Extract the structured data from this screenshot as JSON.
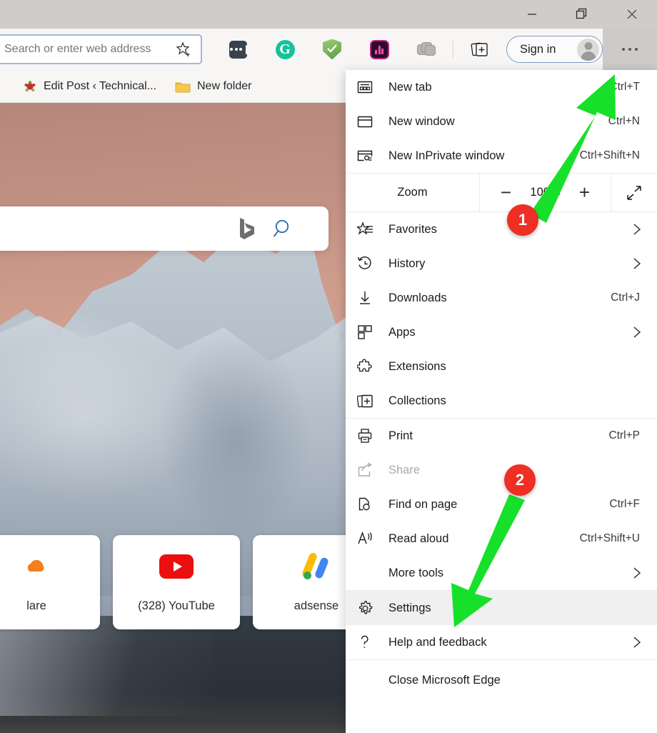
{
  "window": {
    "controls": [
      {
        "name": "minimize",
        "glyph": "minimize-icon"
      },
      {
        "name": "restore",
        "glyph": "restore-icon"
      },
      {
        "name": "close",
        "glyph": "close-icon"
      }
    ]
  },
  "toolbar": {
    "address_value": "",
    "address_placeholder": "Search or enter web address",
    "favorite_icon": "add-favorite-star-icon",
    "extensions": [
      {
        "name": "password-manager-extension",
        "icon": "password-dots-icon"
      },
      {
        "name": "grammarly-extension",
        "icon": "grammarly-g-icon",
        "letter": "G"
      },
      {
        "name": "adblock-shield-extension",
        "icon": "shield-check-icon"
      },
      {
        "name": "analytics-extension",
        "icon": "purple-bars-icon"
      },
      {
        "name": "screenshot-extension",
        "icon": "grey-stack-icon"
      }
    ],
    "collections_icon": "collections-icon",
    "signin_label": "Sign in",
    "avatar_icon": "default-avatar-icon",
    "settings_and_more_icon": "ellipsis-icon"
  },
  "bookmarks": [
    {
      "label": "Edit Post ‹ Technical...",
      "icon": "wordpress-favicon"
    },
    {
      "label": "New folder",
      "icon": "folder-icon"
    }
  ],
  "newtab": {
    "search_placeholder": "",
    "bing_icon": "bing-b-icon",
    "search_icon": "magnifier-icon",
    "tiles": [
      {
        "label": "lare",
        "icon": "cloudflare-icon",
        "partial": true
      },
      {
        "label": "(328) YouTube",
        "icon": "youtube-icon"
      },
      {
        "label": "adsense",
        "icon": "google-adsense-icon"
      }
    ]
  },
  "menu": {
    "groups": [
      {
        "name": "new-group",
        "items": [
          {
            "label": "New tab",
            "shortcut": "Ctrl+T",
            "icon": "new-tab-icon",
            "name": "new-tab"
          },
          {
            "label": "New window",
            "shortcut": "Ctrl+N",
            "icon": "new-window-icon",
            "name": "new-window"
          },
          {
            "label": "New InPrivate window",
            "shortcut": "Ctrl+Shift+N",
            "icon": "inprivate-icon",
            "name": "new-inprivate-window"
          }
        ]
      },
      {
        "name": "zoom-group",
        "zoom": {
          "label": "Zoom",
          "value": "100%",
          "minus_label": "−",
          "plus_label": "+",
          "fullscreen_icon": "fullscreen-icon"
        }
      },
      {
        "name": "browsing-group",
        "items": [
          {
            "label": "Favorites",
            "shortcut": "",
            "icon": "favorites-star-icon",
            "chevron": true,
            "name": "favorites"
          },
          {
            "label": "History",
            "shortcut": "",
            "icon": "history-clock-icon",
            "chevron": true,
            "name": "history"
          },
          {
            "label": "Downloads",
            "shortcut": "Ctrl+J",
            "icon": "download-arrow-icon",
            "chevron": false,
            "name": "downloads"
          },
          {
            "label": "Apps",
            "shortcut": "",
            "icon": "apps-grid-icon",
            "chevron": true,
            "name": "apps"
          },
          {
            "label": "Extensions",
            "shortcut": "",
            "icon": "puzzle-piece-icon",
            "chevron": false,
            "name": "extensions"
          },
          {
            "label": "Collections",
            "shortcut": "",
            "icon": "collections-icon",
            "chevron": false,
            "name": "collections"
          }
        ]
      },
      {
        "name": "tools-group",
        "items": [
          {
            "label": "Print",
            "shortcut": "Ctrl+P",
            "icon": "printer-icon",
            "chevron": false,
            "name": "print"
          },
          {
            "label": "Share",
            "shortcut": "",
            "icon": "share-icon",
            "chevron": false,
            "name": "share",
            "disabled": true
          },
          {
            "label": "Find on page",
            "shortcut": "Ctrl+F",
            "icon": "find-page-icon",
            "chevron": false,
            "name": "find-on-page"
          },
          {
            "label": "Read aloud",
            "shortcut": "Ctrl+Shift+U",
            "icon": "read-aloud-icon",
            "chevron": false,
            "name": "read-aloud"
          },
          {
            "label": "More tools",
            "shortcut": "",
            "icon": "",
            "chevron": true,
            "name": "more-tools"
          }
        ]
      },
      {
        "name": "settings-group",
        "items": [
          {
            "label": "Settings",
            "shortcut": "",
            "icon": "gear-icon",
            "chevron": false,
            "name": "settings",
            "hovered": true
          },
          {
            "label": "Help and feedback",
            "shortcut": "",
            "icon": "question-icon",
            "chevron": true,
            "name": "help-and-feedback"
          }
        ]
      },
      {
        "name": "close-group",
        "items": [
          {
            "label": "Close Microsoft Edge",
            "shortcut": "",
            "icon": "",
            "chevron": false,
            "name": "close-microsoft-edge"
          }
        ]
      }
    ]
  },
  "annotations": {
    "arrow_color": "#17e02a",
    "badge_color": "#ef2e24",
    "items": [
      {
        "number": "1",
        "target": "settings-and-more-ellipsis-button"
      },
      {
        "number": "2",
        "target": "settings-menu-item"
      }
    ]
  }
}
